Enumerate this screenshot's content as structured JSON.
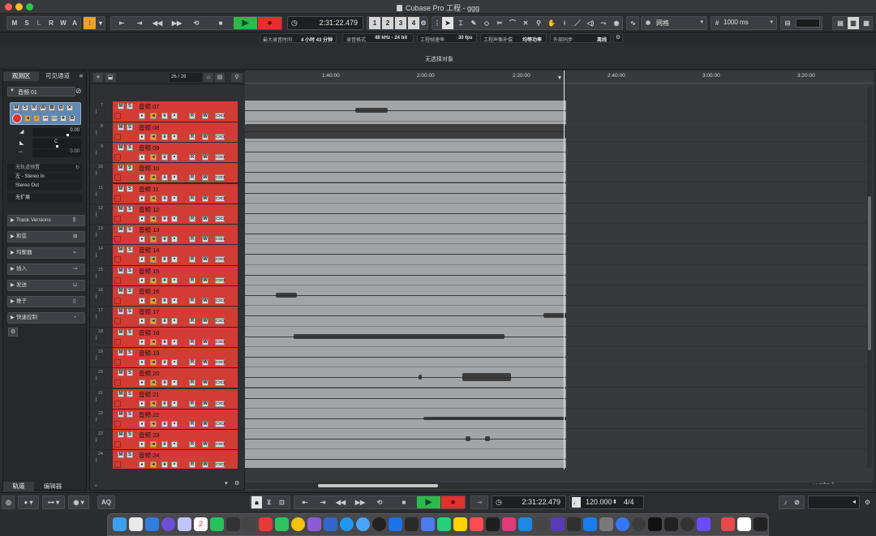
{
  "window": {
    "title": "Cubase Pro 工程 - ggg"
  },
  "toolbar": {
    "modes": [
      "M",
      "S",
      "L",
      "R",
      "W",
      "A"
    ],
    "time_display": "2:31:22.479",
    "num_buttons": [
      "1",
      "2",
      "3",
      "4"
    ],
    "grid_type": "网格",
    "grid_value": "1000 ms"
  },
  "project_info": [
    {
      "label": "最大录音时间",
      "value": "4 小时 43 分钟"
    },
    {
      "label": "录音格式",
      "value": "48 kHz - 24 bit"
    },
    {
      "label": "工程帧速率",
      "value": "30 fps"
    },
    {
      "label": "工程声像补偿",
      "value": "均等功率"
    },
    {
      "label": "外部同步",
      "value": "离线"
    }
  ],
  "status": {
    "no_selection": "无选择对象"
  },
  "left_panel": {
    "tabs": [
      "观测区",
      "可见通道"
    ],
    "channel_name": "音频 01",
    "volume": "0.00",
    "pan": "C",
    "pan_value": "0.00",
    "routing": [
      "无轨道预置",
      "左 - Stereo In",
      "Stereo Out",
      "无扩展"
    ],
    "sections": [
      "Track Versions",
      "和弦",
      "均衡器",
      "插入",
      "发送",
      "推子",
      "快速控制"
    ],
    "bottom_tabs": [
      "轨道",
      "编辑器"
    ]
  },
  "track_list": {
    "counter": "26 / 26"
  },
  "ruler": {
    "labels": [
      "1:40:00",
      "2:00:00",
      "2:20:00",
      "2:40:00",
      "3:00:00",
      "3:20:00"
    ]
  },
  "track_buttons": {
    "m": "M",
    "s": "S",
    "r": "R",
    "w": "W"
  },
  "tracks": [
    {
      "num": "7",
      "name": "音频 07"
    },
    {
      "num": "8",
      "name": "音频 08"
    },
    {
      "num": "9",
      "name": "音频 09"
    },
    {
      "num": "10",
      "name": "音频 10"
    },
    {
      "num": "11",
      "name": "音频 11"
    },
    {
      "num": "12",
      "name": "音频 12"
    },
    {
      "num": "13",
      "name": "音频 13"
    },
    {
      "num": "14",
      "name": "音频 14"
    },
    {
      "num": "15",
      "name": "音频 15"
    },
    {
      "num": "16",
      "name": "音频 16"
    },
    {
      "num": "17",
      "name": "音频 17"
    },
    {
      "num": "18",
      "name": "音频 18"
    },
    {
      "num": "19",
      "name": "音频 19"
    },
    {
      "num": "20",
      "name": "音频 20"
    },
    {
      "num": "21",
      "name": "音频 21"
    },
    {
      "num": "22",
      "name": "音频 22"
    },
    {
      "num": "23",
      "name": "音频 23"
    },
    {
      "num": "24",
      "name": "音频 24"
    }
  ],
  "transport": {
    "time": "2:31:22.479",
    "tempo": "120.000",
    "signature": "4/4",
    "aq": "AQ"
  },
  "dock": {
    "calendar_day": "2"
  },
  "colors": {
    "track_red": "#d33b35",
    "play_green": "#2fb84a",
    "record_red": "#e0312d",
    "clip_grey": "#a2a4a6",
    "accent_orange": "#f0a02c"
  }
}
